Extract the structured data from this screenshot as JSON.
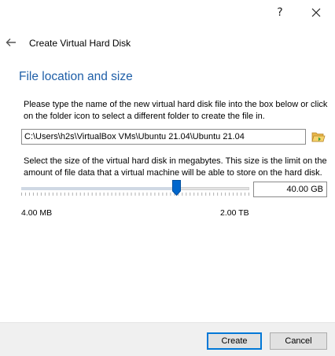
{
  "titlebar": {
    "help_label": "?",
    "help_icon": "question-mark-icon",
    "close_icon": "close-icon"
  },
  "header": {
    "back_icon": "back-arrow-icon",
    "title": "Create Virtual Hard Disk"
  },
  "section": {
    "title": "File location and size"
  },
  "file_location": {
    "description": "Please type the name of the new virtual hard disk file into the box below or click on the folder icon to select a different folder to create the file in.",
    "path_value": "C:\\Users\\h2s\\VirtualBox VMs\\Ubuntu 21.04\\Ubuntu 21.04",
    "folder_icon": "folder-open-icon"
  },
  "size": {
    "description": "Select the size of the virtual hard disk in megabytes. This size is the limit on the amount of file data that a virtual machine will be able to store on the hard disk.",
    "value": "40.00 GB",
    "slider_fraction": 0.68,
    "min_label": "4.00 MB",
    "max_label": "2.00 TB"
  },
  "buttons": {
    "create": "Create",
    "cancel": "Cancel"
  },
  "colors": {
    "accent": "#1f5fa8",
    "focus": "#0078d7",
    "thumb": "#0066cc"
  }
}
